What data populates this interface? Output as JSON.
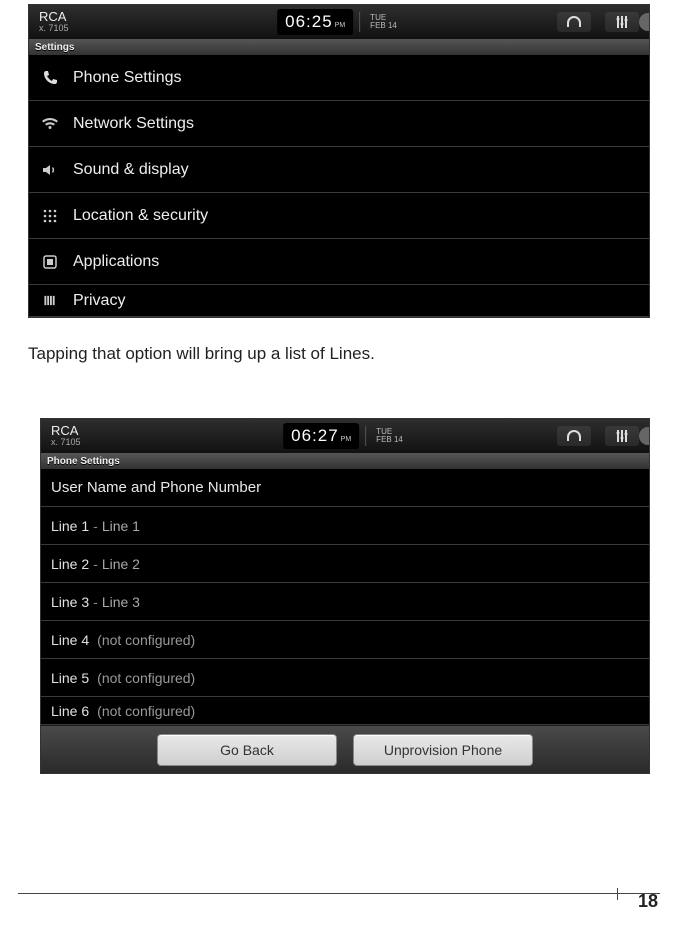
{
  "screenshot1": {
    "statusbar": {
      "brand": "RCA",
      "ext": "x. 7105",
      "time": "06:25",
      "ampm": "PM",
      "dow": "TUE",
      "date": "FEB 14"
    },
    "crumb": "Settings",
    "menu": [
      {
        "icon": "phone",
        "label": "Phone Settings"
      },
      {
        "icon": "wifi",
        "label": "Network Settings"
      },
      {
        "icon": "speaker",
        "label": "Sound & display"
      },
      {
        "icon": "grid",
        "label": "Location & security"
      },
      {
        "icon": "app",
        "label": "Applications"
      },
      {
        "icon": "privacy",
        "label": "Privacy"
      }
    ]
  },
  "caption": "Tapping that option will bring up a list of Lines.",
  "screenshot2": {
    "statusbar": {
      "brand": "RCA",
      "ext": "x. 7105",
      "time": "06:27",
      "ampm": "PM",
      "dow": "TUE",
      "date": "FEB 14"
    },
    "crumb": "Phone Settings",
    "header": "User Name and Phone Number",
    "lines": [
      {
        "num": "Line 1",
        "name": "Line 1",
        "configured": true
      },
      {
        "num": "Line 2",
        "name": "Line 2",
        "configured": true
      },
      {
        "num": "Line 3",
        "name": "Line 3",
        "configured": true
      },
      {
        "num": "Line 4",
        "name": "",
        "configured": false
      },
      {
        "num": "Line 5",
        "name": "",
        "configured": false
      },
      {
        "num": "Line 6",
        "name": "",
        "configured": false
      }
    ],
    "not_configured_label": "(not configured)",
    "buttons": {
      "back": "Go Back",
      "unprovision": "Unprovision Phone"
    }
  },
  "page_number": "18"
}
